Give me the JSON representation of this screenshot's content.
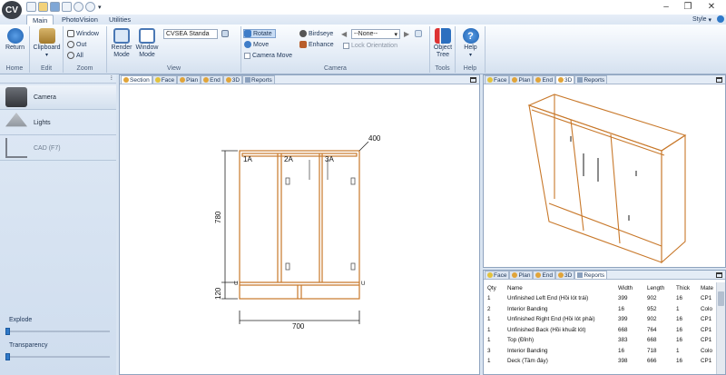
{
  "app": {
    "logo": "CV",
    "style_label": "Style"
  },
  "titlebar": {
    "quick_access": [
      "new-icon",
      "open-icon",
      "save-icon",
      "print-icon",
      "undo-icon",
      "redo-icon",
      "dropdown-icon"
    ],
    "window_controls": [
      "minimize-icon",
      "restore-icon",
      "close-icon"
    ]
  },
  "ribbon_tabs": [
    "Main",
    "PhotoVision",
    "Utilities"
  ],
  "ribbon": {
    "home": {
      "label": "Home",
      "return": "Return"
    },
    "edit": {
      "label": "Edit",
      "clipboard": "Clipboard"
    },
    "zoom": {
      "label": "Zoom",
      "window": "Window",
      "out": "Out",
      "all": "All"
    },
    "view": {
      "label": "View",
      "render_mode": "Render\nMode",
      "window_mode": "Window\nMode",
      "combo_value": "CVSEA Standa"
    },
    "camera": {
      "label": "Camera",
      "rotate": "Rotate",
      "move": "Move",
      "camera_move": "Camera Move",
      "birdseye": "Birdseye",
      "enhance": "Enhance",
      "none_option": "--None--",
      "lock_orientation": "Lock Orientation"
    },
    "tools": {
      "label": "Tools",
      "object_tree": "Object\nTree"
    },
    "help": {
      "label": "Help",
      "help": "Help"
    }
  },
  "sidebar": {
    "items": [
      "Camera",
      "Lights",
      "CAD (F7)"
    ],
    "explode_label": "Explode",
    "transparency_label": "Transparency",
    "explode_value": 0,
    "transparency_value": 0
  },
  "left_pane": {
    "tabs": [
      "Section",
      "Face",
      "Plan",
      "End",
      "3D",
      "Reports"
    ],
    "active": "Section"
  },
  "drawing": {
    "dim_top": "400",
    "dim_height": "780",
    "dim_base": "120",
    "dim_width": "700",
    "doors": [
      "1A",
      "2A",
      "3A"
    ],
    "marker": "U"
  },
  "right_top_pane": {
    "tabs": [
      "Face",
      "Plan",
      "End",
      "3D",
      "Reports"
    ],
    "active": "3D"
  },
  "right_bottom_pane": {
    "tabs": [
      "Face",
      "Plan",
      "End",
      "3D",
      "Reports"
    ],
    "active": "Reports"
  },
  "report": {
    "columns": [
      "Qty",
      "Name",
      "Width",
      "Length",
      "Thick",
      "Mate"
    ],
    "rows": [
      [
        "1",
        "Unfinished Left End (Hồi lót trái)",
        "399",
        "902",
        "16",
        "CP1"
      ],
      [
        "2",
        "Interior Banding",
        "16",
        "952",
        "1",
        "Colo"
      ],
      [
        "1",
        "Unfinished Right End (Hồi lót phải)",
        "399",
        "902",
        "16",
        "CP1"
      ],
      [
        "1",
        "Unfinished Back (Hồi khuất lót)",
        "668",
        "764",
        "16",
        "CP1"
      ],
      [
        "1",
        "Top (Đỉnh)",
        "383",
        "668",
        "16",
        "CP1"
      ],
      [
        "3",
        "Interior Banding",
        "16",
        "718",
        "1",
        "Colo"
      ],
      [
        "1",
        "Deck (Tầm đáy)",
        "398",
        "666",
        "16",
        "CP1"
      ]
    ]
  }
}
